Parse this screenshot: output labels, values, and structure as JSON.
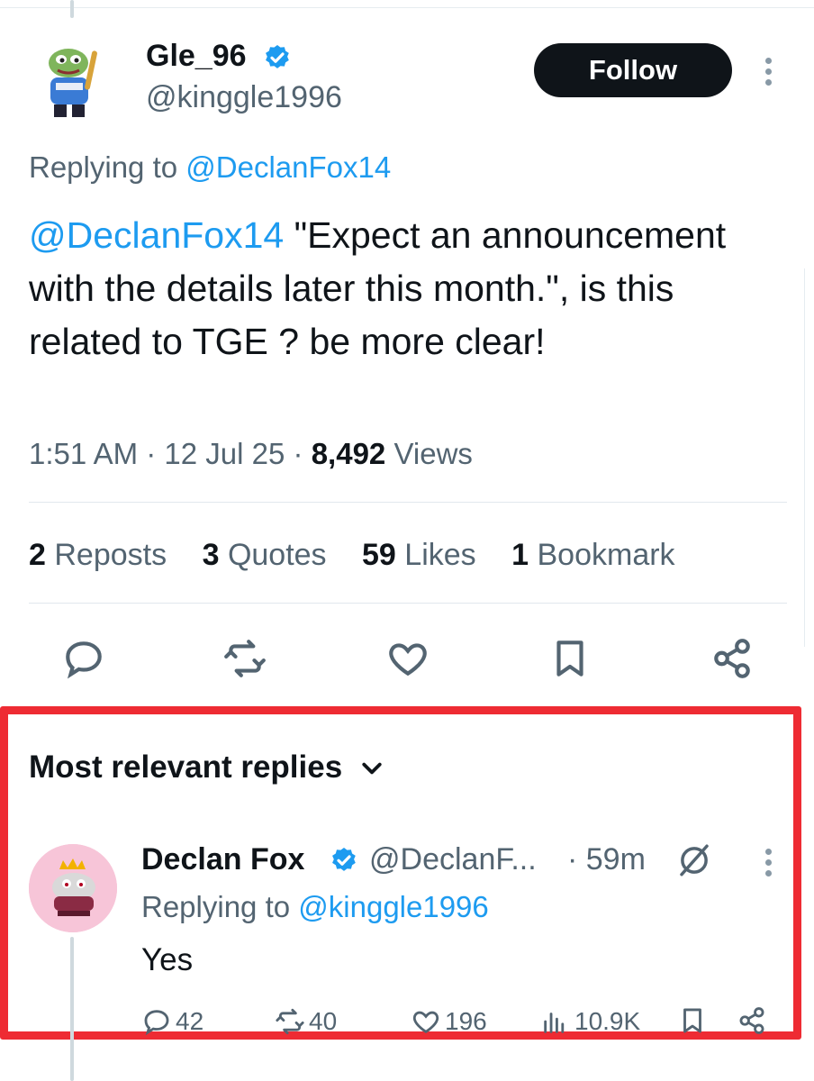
{
  "tweet": {
    "author": {
      "name": "Gle_96",
      "handle": "@kinggle1996",
      "verified": true
    },
    "follow_label": "Follow",
    "replying_prefix": "Replying to",
    "replying_handle": "@DeclanFox14",
    "mention": "@DeclanFox14",
    "text": " \"Expect an announcement with the details later this month.\", is this related to TGE ? be more clear!",
    "time": "1:51 AM",
    "date": "12 Jul 25",
    "views_count": "8,492",
    "views_label": "Views",
    "stats": [
      {
        "count": "2",
        "label": "Reposts"
      },
      {
        "count": "3",
        "label": "Quotes"
      },
      {
        "count": "59",
        "label": "Likes"
      },
      {
        "count": "1",
        "label": "Bookmark"
      }
    ],
    "actions": [
      "reply-icon",
      "repost-icon",
      "like-icon",
      "bookmark-icon",
      "share-icon"
    ]
  },
  "replies_section": {
    "sort_label": "Most relevant replies",
    "highlight_color": "#ee2b33"
  },
  "reply": {
    "author": {
      "name": "Declan Fox",
      "handle": "@DeclanF...",
      "verified": true
    },
    "time": "· 59m",
    "replying_prefix": "Replying to",
    "replying_handle": "@kinggle1996",
    "text": "Yes",
    "reply_count": "42",
    "repost_count": "40",
    "like_count": "196",
    "view_count": "10.9K"
  },
  "colors": {
    "accent": "#1d9bf0",
    "text": "#0f1419",
    "muted": "#536471",
    "button": "#0f1419"
  }
}
